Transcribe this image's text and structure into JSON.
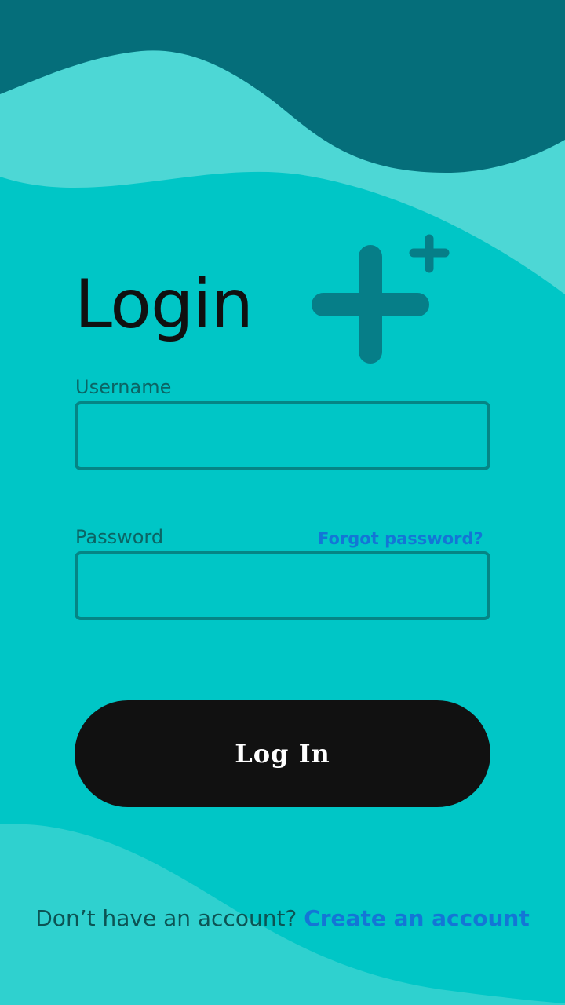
{
  "colors": {
    "background": "#00c6c6",
    "wave_dark": "#056e7a",
    "wave_light": "#4dd7d5",
    "wave_bottom": "#2fd1cf",
    "logo": "#067e88",
    "input_border": "#058585",
    "button": "#111111",
    "link": "#1376d6"
  },
  "logo": {
    "icon": "plus-plus-icon"
  },
  "login": {
    "title": "Login",
    "username_label": "Username",
    "username_value": "",
    "password_label": "Password",
    "password_value": "",
    "forgot_password": "Forgot password?",
    "submit_label": "Log In"
  },
  "signup": {
    "prompt": "Don’t have an account?",
    "link": "Create an account"
  }
}
